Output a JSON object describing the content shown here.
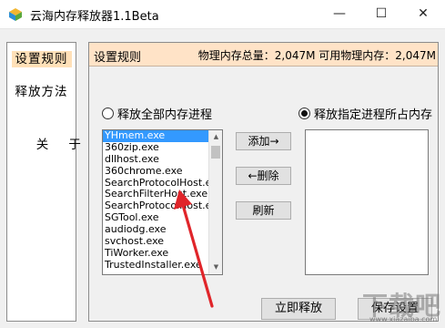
{
  "window": {
    "title": "云海内存释放器1.1Beta",
    "minimize": "—",
    "maximize": "☐",
    "close": "✕"
  },
  "nav": {
    "items": [
      {
        "label": "设置规则",
        "active": true
      },
      {
        "label": "释放方法"
      },
      {
        "label": "关    于"
      }
    ]
  },
  "panel": {
    "title": "设置规则",
    "mem_info": "物理内存总量：2,047M 可用物理内存：2,047M"
  },
  "radios": {
    "release_all": "释放全部内存进程",
    "release_specified": "释放指定进程所占内存",
    "selected": "release_specified"
  },
  "process_list": {
    "items": [
      "YHmem.exe",
      "360zip.exe",
      "dllhost.exe",
      "360chrome.exe",
      "SearchProtocolHost.exe",
      "SearchFilterHost.exe",
      "SearchProtocolHost.exe",
      "SGTool.exe",
      "audiodg.exe",
      "svchost.exe",
      "TiWorker.exe",
      "TrustedInstaller.exe"
    ],
    "selected_index": 0
  },
  "buttons": {
    "add": "添加→",
    "remove": "←删除",
    "refresh": "刷新",
    "release_now": "立即释放",
    "save_settings": "保存设置"
  },
  "watermark": {
    "text": "下载吧",
    "sub": "www.xiazaiba.com"
  },
  "colors": {
    "panel_header": "#ffe3c7",
    "selected_item": "#3399ff",
    "annotation_arrow": "#e0252a"
  }
}
